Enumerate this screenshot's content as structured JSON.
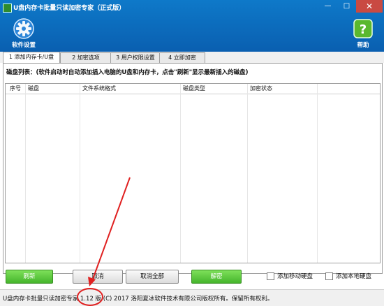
{
  "window": {
    "title": "U盘内存卡批量只读加密专家（正式版）",
    "minimize": "—",
    "maximize": "□",
    "close": "✕"
  },
  "toolbar": {
    "settings_label": "软件设置",
    "help_label": "帮助"
  },
  "tabs": [
    {
      "label": "1 添加内存卡/U盘",
      "active": true
    },
    {
      "label": "2 加密选项",
      "active": false
    },
    {
      "label": "3 用户权限设置",
      "active": false
    },
    {
      "label": "4 立即加密",
      "active": false
    }
  ],
  "disk_list": {
    "label": "磁盘列表：(软件启动时自动添加插入电脑的U盘和内存卡，点击\"刷新\"显示最新插入的磁盘)",
    "columns": [
      "序号",
      "磁盘",
      "文件系统格式",
      "磁盘类型",
      "加密状态"
    ],
    "rows": []
  },
  "buttons": {
    "refresh": "刷新",
    "cancel": "取消",
    "cancel_all": "取消全部",
    "decrypt": "解密"
  },
  "checkboxes": {
    "add_mobile_disk": {
      "label": "添加移动硬盘",
      "checked": false
    },
    "add_local_disk": {
      "label": "添加本地硬盘",
      "checked": false
    }
  },
  "statusbar": {
    "text": "U盘内存卡批量只读加密专家 1.12 版 (C) 2017 洛阳夏冰软件技术有限公司版权所有。保留所有权利。"
  },
  "colors": {
    "header_blue": "#0a6fc0",
    "green_button": "#45b52c",
    "annotation_red": "#e02020"
  },
  "icons": {
    "settings": "gear-icon",
    "help": "help-icon"
  }
}
